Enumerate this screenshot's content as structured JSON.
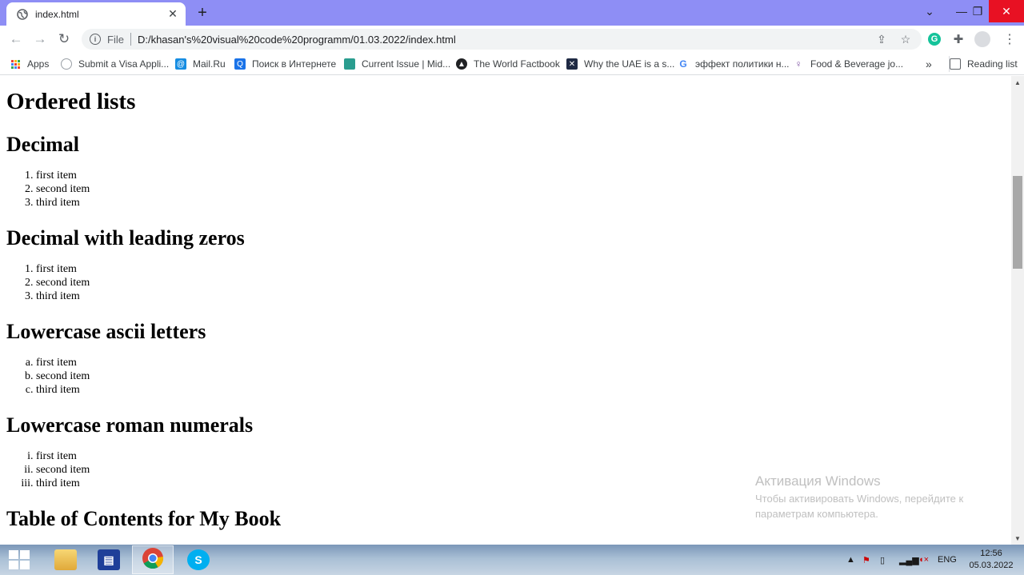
{
  "browser": {
    "tab": {
      "title": "index.html"
    },
    "address_bar": {
      "scheme_label": "File",
      "url": "D:/khasan's%20visual%20code%20programm/01.03.2022/index.html"
    },
    "bookmarks": [
      {
        "label": "Apps",
        "icon": "apps-grid-icon"
      },
      {
        "label": "Submit a Visa Appli...",
        "icon": "visa-site-icon"
      },
      {
        "label": "Mail.Ru",
        "icon": "mailru-icon"
      },
      {
        "label": "Поиск в Интернете",
        "icon": "search-site-icon"
      },
      {
        "label": "Current Issue | Mid...",
        "icon": "journal-icon"
      },
      {
        "label": "The World Factbook",
        "icon": "factbook-icon"
      },
      {
        "label": "Why the UAE is a s...",
        "icon": "article-icon"
      },
      {
        "label": "эффект политики н...",
        "icon": "google-icon"
      },
      {
        "label": "Food & Beverage jo...",
        "icon": "jobs-icon"
      }
    ],
    "overflow_label": "»",
    "reading_list_label": "Reading list"
  },
  "page": {
    "title": "Ordered lists",
    "sections": [
      {
        "heading": "Decimal",
        "items": [
          "first item",
          "second item",
          "third item"
        ]
      },
      {
        "heading": "Decimal with leading zeros",
        "items": [
          "first item",
          "second item",
          "third item"
        ]
      },
      {
        "heading": "Lowercase ascii letters",
        "items": [
          "first item",
          "second item",
          "third item"
        ]
      },
      {
        "heading": "Lowercase roman numerals",
        "items": [
          "first item",
          "second item",
          "third item"
        ]
      },
      {
        "heading": "Table of Contents for My Book"
      }
    ]
  },
  "activation_watermark": {
    "title": "Активация Windows",
    "line1": "Чтобы активировать Windows, перейдите к",
    "line2": "параметрам компьютера."
  },
  "taskbar": {
    "language": "ENG",
    "time": "12:56",
    "date": "05.03.2022"
  },
  "colors": {
    "tabstrip": "#8e8ef5",
    "close_button": "#e81123",
    "scroll_thumb": "#a8a8a8"
  }
}
